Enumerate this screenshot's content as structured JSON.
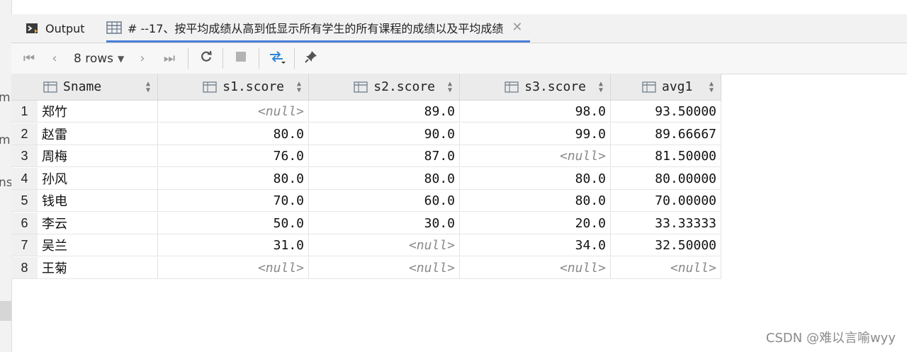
{
  "left_fragments": [
    "m",
    "m",
    "ns"
  ],
  "tabs": {
    "output_label": "Output",
    "result_label": "# --17、按平均成绩从高到低显示所有学生的所有课程的成绩以及平均成绩"
  },
  "toolbar": {
    "rows_label": "8 rows"
  },
  "columns": [
    "Sname",
    "s1.score",
    "s2.score",
    "s3.score",
    "avg1"
  ],
  "rows": [
    {
      "num": "1",
      "cells": [
        "郑竹",
        "<null>",
        "89.0",
        "98.0",
        "93.50000"
      ]
    },
    {
      "num": "2",
      "cells": [
        "赵雷",
        "80.0",
        "90.0",
        "99.0",
        "89.66667"
      ]
    },
    {
      "num": "3",
      "cells": [
        "周梅",
        "76.0",
        "87.0",
        "<null>",
        "81.50000"
      ]
    },
    {
      "num": "4",
      "cells": [
        "孙风",
        "80.0",
        "80.0",
        "80.0",
        "80.00000"
      ]
    },
    {
      "num": "5",
      "cells": [
        "钱电",
        "70.0",
        "60.0",
        "80.0",
        "70.00000"
      ]
    },
    {
      "num": "6",
      "cells": [
        "李云",
        "50.0",
        "30.0",
        "20.0",
        "33.33333"
      ]
    },
    {
      "num": "7",
      "cells": [
        "吴兰",
        "31.0",
        "<null>",
        "34.0",
        "32.50000"
      ]
    },
    {
      "num": "8",
      "cells": [
        "王菊",
        "<null>",
        "<null>",
        "<null>",
        "<null>"
      ]
    }
  ],
  "watermark": "CSDN @难以言喻wyy",
  "colors": {
    "accent": "#4a7fd8",
    "action_blue": "#2f86d6"
  }
}
